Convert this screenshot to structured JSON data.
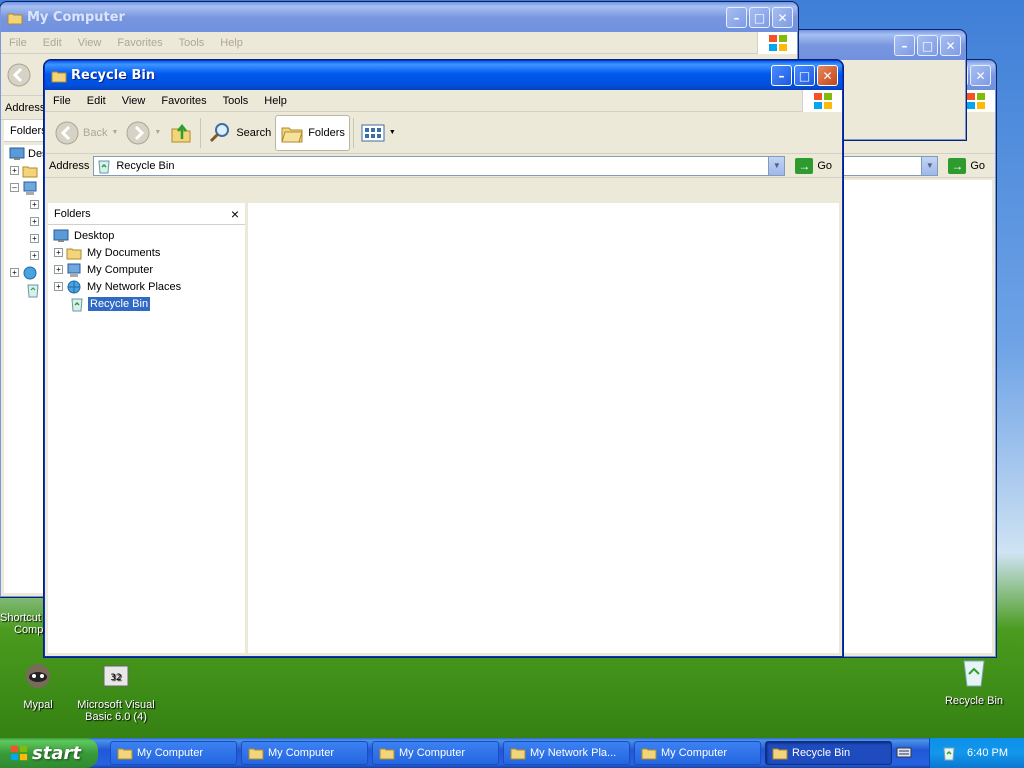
{
  "desktop": {
    "icons": [
      {
        "label": "Mypal"
      },
      {
        "label": "Microsoft Visual Basic 6.0 (4)"
      },
      {
        "label": "Recycle Bin"
      },
      {
        "label": "Shortcut"
      },
      {
        "label": "Comp"
      }
    ]
  },
  "bg_window_1": {
    "title": "My Computer",
    "menu": [
      "File",
      "Edit",
      "View",
      "Favorites",
      "Tools",
      "Help"
    ],
    "address_label": "Address",
    "folders_label": "Folders",
    "desktop_label": "Desk"
  },
  "bg_window_2": {
    "go_label": "Go"
  },
  "bg_window_3": {
    "go_label": "Go"
  },
  "main_window": {
    "title": "Recycle Bin",
    "menu": [
      "File",
      "Edit",
      "View",
      "Favorites",
      "Tools",
      "Help"
    ],
    "toolbar": {
      "back": "Back",
      "search": "Search",
      "folders": "Folders"
    },
    "address": {
      "label": "Address",
      "value": "Recycle Bin",
      "go": "Go"
    },
    "folders_pane": {
      "title": "Folders",
      "close": "×",
      "tree": [
        {
          "label": "Desktop",
          "level": 0,
          "expander": "",
          "icon": "desktop-icon"
        },
        {
          "label": "My Documents",
          "level": 1,
          "expander": "+",
          "icon": "folder-icon"
        },
        {
          "label": "My Computer",
          "level": 1,
          "expander": "+",
          "icon": "computer-icon"
        },
        {
          "label": "My Network Places",
          "level": 1,
          "expander": "+",
          "icon": "network-icon"
        },
        {
          "label": "Recycle Bin",
          "level": 1,
          "expander": "",
          "icon": "recycle-bin-icon",
          "selected": true
        }
      ]
    }
  },
  "taskbar": {
    "start_label": "start",
    "tasks": [
      {
        "label": "My Computer",
        "active": false
      },
      {
        "label": "My Computer",
        "active": false
      },
      {
        "label": "My Computer",
        "active": false
      },
      {
        "label": "My Network Pla...",
        "active": false
      },
      {
        "label": "My Computer",
        "active": false
      },
      {
        "label": "Recycle Bin",
        "active": true
      }
    ],
    "clock": "6:40 PM"
  },
  "colors": {
    "title_active": "#0058ee",
    "selection": "#316ac5",
    "start_green": "#3a9b3a",
    "taskbar_blue": "#2157d7"
  }
}
